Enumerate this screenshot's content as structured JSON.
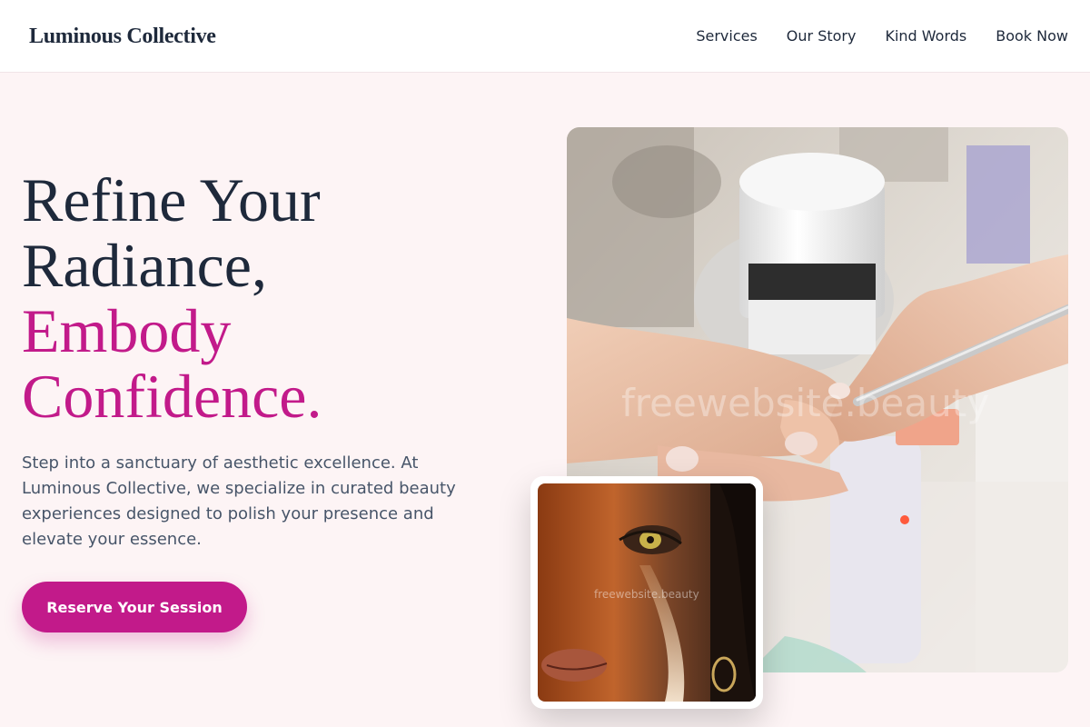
{
  "brand": {
    "name": "Luminous Collective"
  },
  "nav": {
    "items": [
      {
        "label": "Services"
      },
      {
        "label": "Our Story"
      },
      {
        "label": "Kind Words"
      },
      {
        "label": "Book Now"
      }
    ]
  },
  "hero": {
    "title_line1": "Refine Your",
    "title_line2": "Radiance,",
    "title_line3": "Embody",
    "title_line4": "Confidence.",
    "description": "Step into a sanctuary of aesthetic excellence. At Luminous Collective, we specialize in curated beauty experiences designed to polish your presence and elevate your essence.",
    "cta_label": "Reserve Your Session"
  },
  "images": {
    "main_watermark": "freewebsite.beauty",
    "small_watermark": "freewebsite.beauty"
  },
  "colors": {
    "accent": "#c21a8a",
    "heading": "#1e293b",
    "body_text": "#475569",
    "page_background": "#fdf4f5"
  }
}
